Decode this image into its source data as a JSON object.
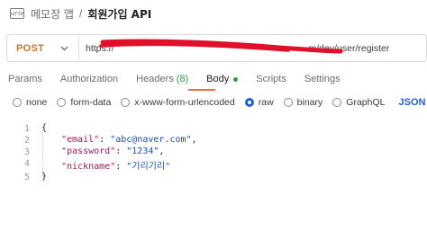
{
  "breadcrumb": {
    "parent": "메모장 앱",
    "separator": "/",
    "current": "회원가입 API"
  },
  "request": {
    "method": "POST",
    "url_prefix": "https://",
    "url_suffix": "m/dev/user/register",
    "url_redacted": true
  },
  "tabs": [
    {
      "label": "Params"
    },
    {
      "label": "Authorization"
    },
    {
      "label": "Headers",
      "count": "(8)"
    },
    {
      "label": "Body",
      "active": true,
      "indicator": "green-dot"
    },
    {
      "label": "Scripts"
    },
    {
      "label": "Settings"
    }
  ],
  "body_types": [
    {
      "label": "none",
      "selected": false
    },
    {
      "label": "form-data",
      "selected": false
    },
    {
      "label": "x-www-form-urlencoded",
      "selected": false
    },
    {
      "label": "raw",
      "selected": true
    },
    {
      "label": "binary",
      "selected": false
    },
    {
      "label": "GraphQL",
      "selected": false
    }
  ],
  "format": "JSON",
  "editor": {
    "line_numbers": [
      "1",
      "2",
      "3",
      "4",
      "5"
    ],
    "open_brace": "{",
    "close_brace": "}",
    "fields": [
      {
        "key": "\"email\"",
        "value": "\"abc@naver.com\"",
        "trail": ","
      },
      {
        "key": "\"password\"",
        "value": "\"1234\"",
        "trail": ","
      },
      {
        "key": "\"nickname\"",
        "value": "\"기리기리\"",
        "trail": ""
      }
    ]
  },
  "colors": {
    "method": "#c8772a",
    "active_tab_underline": "#f26b3a",
    "radio_selected": "#1f5ed8",
    "json_key": "#a3174f",
    "json_string": "#1f4fb0",
    "redaction": "#e0102a"
  },
  "icons": {
    "http": "http-request-icon",
    "method_dropdown": "chevron-down-icon",
    "format_dropdown": "chevron-down-icon"
  }
}
